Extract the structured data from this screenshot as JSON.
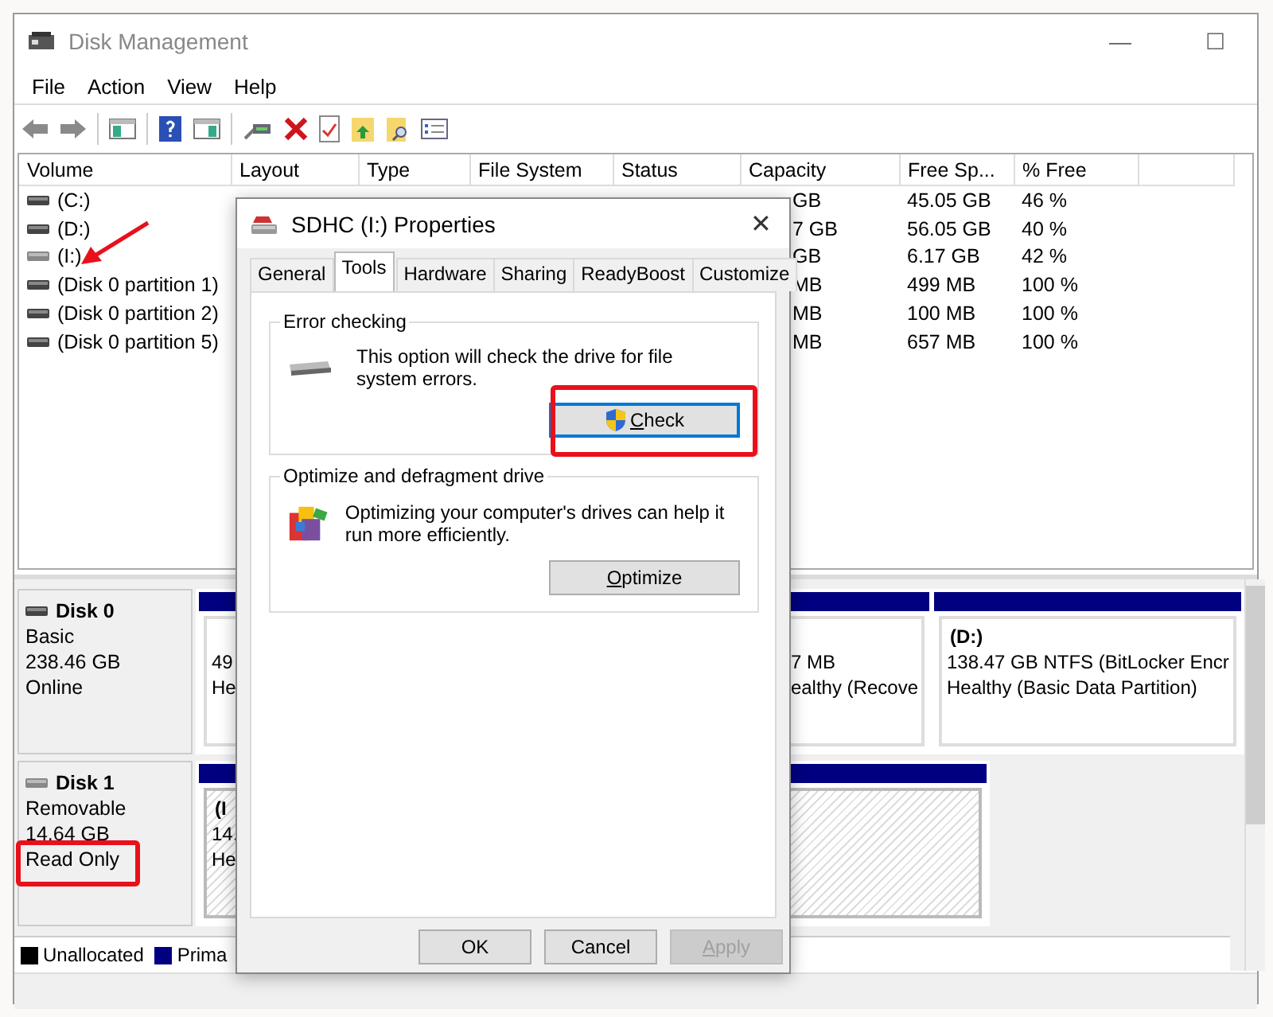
{
  "window": {
    "title": "Disk Management",
    "controls": [
      "—",
      "☐"
    ]
  },
  "menu": [
    "File",
    "Action",
    "View",
    "Help"
  ],
  "volume_table": {
    "columns": [
      "Volume",
      "Layout",
      "Type",
      "File System",
      "Status",
      "Capacity",
      "Free Sp...",
      "% Free"
    ],
    "rows": [
      {
        "volume": "(C:)",
        "capacity": "GB",
        "free": "45.05 GB",
        "pct_free": "46 %",
        "removable": false
      },
      {
        "volume": "(D:)",
        "capacity": "7 GB",
        "free": "56.05 GB",
        "pct_free": "40 %",
        "removable": false
      },
      {
        "volume": "(I:)",
        "capacity": "GB",
        "free": "6.17 GB",
        "pct_free": "42 %",
        "removable": true
      },
      {
        "volume": "(Disk 0 partition 1)",
        "capacity": "MB",
        "free": "499 MB",
        "pct_free": "100 %",
        "removable": false
      },
      {
        "volume": "(Disk 0 partition 2)",
        "capacity": "MB",
        "free": "100 MB",
        "pct_free": "100 %",
        "removable": false
      },
      {
        "volume": "(Disk 0 partition 5)",
        "capacity": "MB",
        "free": "657 MB",
        "pct_free": "100 %",
        "removable": false
      }
    ]
  },
  "disks": [
    {
      "name": "Disk 0",
      "removable": false,
      "lines": [
        "Basic",
        "238.46 GB",
        "Online"
      ],
      "partitions": [
        {
          "lines": [
            "49",
            "He"
          ],
          "hatched": false
        },
        {
          "lines": [
            "7 MB",
            "ealthy (Recove"
          ],
          "hatched": false
        },
        {
          "title": "(D:)",
          "lines": [
            "138.47 GB NTFS (BitLocker Encr",
            "Healthy (Basic Data Partition)"
          ],
          "hatched": false
        }
      ]
    },
    {
      "name": "Disk 1",
      "removable": true,
      "lines": [
        "Removable",
        "14.64 GB",
        "Read Only"
      ],
      "partitions": [
        {
          "title": "(I",
          "lines": [
            "14.",
            "He"
          ],
          "hatched": true
        }
      ]
    }
  ],
  "legend": [
    {
      "label": "Unallocated",
      "color": "#000000"
    },
    {
      "label": "Prima",
      "color": "#000080"
    }
  ],
  "dialog": {
    "title": "SDHC (I:) Properties",
    "close": "✕",
    "tabs": [
      {
        "label": "General",
        "selected": false
      },
      {
        "label": "Tools",
        "selected": true
      },
      {
        "label": "Hardware",
        "selected": false
      },
      {
        "label": "Sharing",
        "selected": false
      },
      {
        "label": "ReadyBoost",
        "selected": false
      },
      {
        "label": "Customize",
        "selected": false
      }
    ],
    "groups": [
      {
        "kind": "check",
        "title": "Error checking",
        "text": "This option will check the drive for file system errors.",
        "button": {
          "label": "Check",
          "access_key_underlined": true,
          "shield": true,
          "focused": true
        }
      },
      {
        "kind": "optimize",
        "title": "Optimize and defragment drive",
        "text": "Optimizing your computer's drives can help it run more efficiently.",
        "button": {
          "label": "Optimize",
          "access_key_underlined": true,
          "shield": false,
          "focused": false
        }
      }
    ],
    "buttons": [
      {
        "label": "OK",
        "disabled": false,
        "access_key_underlined": false
      },
      {
        "label": "Cancel",
        "disabled": false,
        "access_key_underlined": false
      },
      {
        "label": "Apply",
        "disabled": true,
        "access_key_underlined": true
      }
    ]
  }
}
